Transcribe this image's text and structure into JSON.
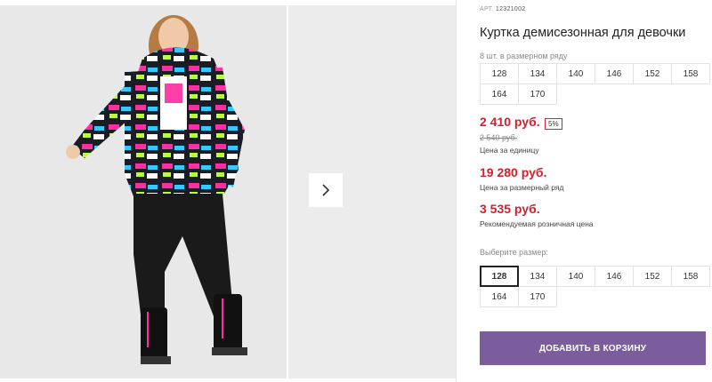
{
  "product": {
    "art_prefix": "АРТ.",
    "art_number": "12321002",
    "title": "Куртка демисезонная для девочки"
  },
  "pack": {
    "label": "8 шт. в размерном ряду",
    "sizes": [
      "128",
      "134",
      "140",
      "146",
      "152",
      "158",
      "164",
      "170"
    ]
  },
  "prices": {
    "unit_price": "2 410 руб.",
    "discount_badge": "5%",
    "old_price": "2 540 руб.",
    "unit_caption": "Цена за единицу",
    "pack_price": "19 280 руб.",
    "pack_caption": "Цена за размерный ряд",
    "retail_price": "3 535 руб.",
    "retail_caption": "Рекомендуемая розничная цена"
  },
  "size_select": {
    "label": "Выберите размер:",
    "sizes": [
      "128",
      "134",
      "140",
      "146",
      "152",
      "158",
      "164",
      "170"
    ],
    "selected": "128"
  },
  "cart_button": {
    "label": "ДОБАВИТЬ В КОРЗИНУ"
  },
  "colors": {
    "accent": "#7b5d9e",
    "price_red": "#d61f2c"
  },
  "icons": {
    "next": "chevron-right-icon"
  }
}
